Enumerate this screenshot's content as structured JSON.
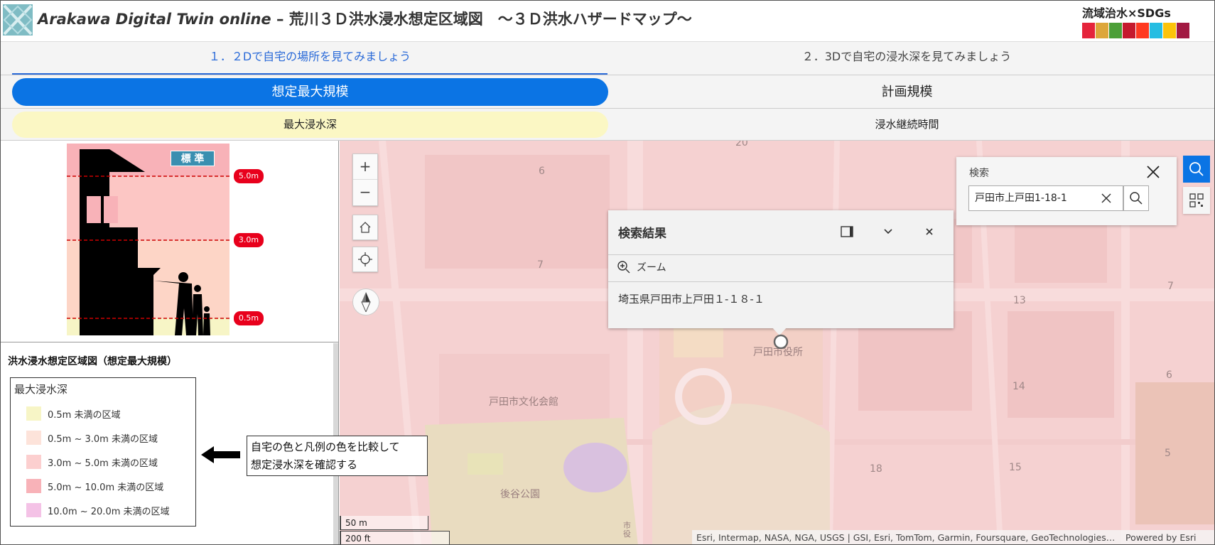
{
  "header": {
    "title_en": "Arakawa Digital Twin online",
    "title_jp": " – 荒川３Ｄ洪水浸水想定区域図　～３Ｄ洪水ハザードマップ～",
    "sdgs_text": "流域治水×SDGs",
    "sdgs_colors": [
      "#e5243b",
      "#dda63a",
      "#4c9f38",
      "#c5192d",
      "#ff3a21",
      "#26bde2",
      "#fcc30b",
      "#a21942"
    ]
  },
  "steps": [
    {
      "label": "１．２Dで自宅の場所を見てみましょう"
    },
    {
      "label": "２．3Dで自宅の浸水深を見てみましょう"
    }
  ],
  "scale_toggle": {
    "options": [
      {
        "label": "想定最大規模"
      },
      {
        "label": "計画規模"
      }
    ],
    "selected": "想定最大規模"
  },
  "mode_toggle": {
    "options": [
      {
        "label": "最大浸水深"
      },
      {
        "label": "浸水継続時間"
      }
    ],
    "selected": "最大浸水深"
  },
  "illustration": {
    "badge": "標 準",
    "levels": [
      {
        "label": "5.0m"
      },
      {
        "label": "3.0m"
      },
      {
        "label": "0.5m"
      }
    ]
  },
  "legend": {
    "heading": "洪水浸水想定区域図（想定最大規模）",
    "box_title": "最大浸水深",
    "items": [
      {
        "label": "0.5m 未満の区域",
        "color": "#f7f5c6"
      },
      {
        "label": "0.5m ~ 3.0m 未満の区域",
        "color": "#fde3da"
      },
      {
        "label": "3.0m ~ 5.0m 未満の区域",
        "color": "#fccfcf"
      },
      {
        "label": "5.0m ~ 10.0m 未満の区域",
        "color": "#f8b2b8"
      },
      {
        "label": "10.0m ~ 20.0m 未満の区域",
        "color": "#f4c2e6"
      }
    ]
  },
  "callout": {
    "line1": "自宅の色と凡例の色を比較して",
    "line2": "想定浸水深を確認する"
  },
  "map": {
    "block_numbers": [
      "20",
      "6",
      "7",
      "7",
      "13",
      "14",
      "6",
      "15",
      "18",
      "5"
    ],
    "places": [
      "戸田市役所",
      "戸田市文化会館",
      "後谷公園",
      "市役"
    ],
    "search": {
      "label": "検索",
      "value": "戸田市上戸田1-18-1"
    },
    "popup": {
      "title": "検索結果",
      "zoom_label": "ズーム",
      "address": "埼玉県戸田市上戸田１-１８-１"
    },
    "scalebar": {
      "metric": "50 m",
      "imperial": "200 ft"
    },
    "attribution": "Esri, Intermap, NASA, NGA, USGS | GSI, Esri, TomTom, Garmin, Foursquare, GeoTechnologies, Inc, METI/NASA, USGS",
    "powered_by": "Powered by Esri"
  }
}
